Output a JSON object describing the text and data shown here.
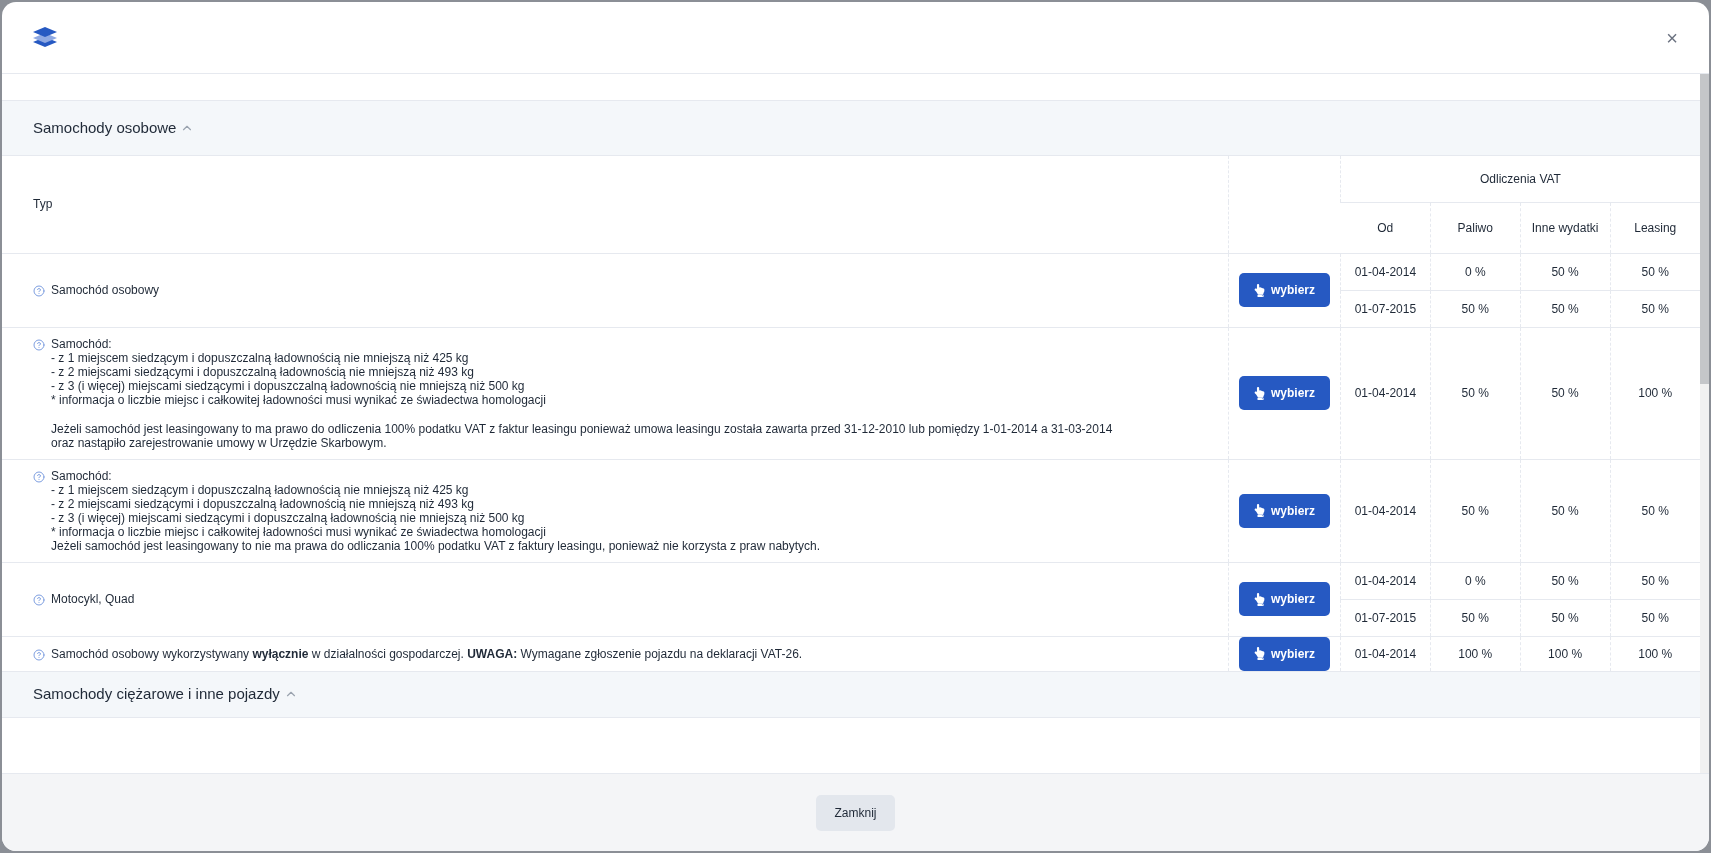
{
  "modal": {
    "close_label": "×",
    "footer_button": "Zamknij"
  },
  "sections": [
    {
      "title": "Samochody osobowe",
      "expanded": true,
      "table": {
        "columns": {
          "type": "Typ",
          "group": "Odliczenia VAT",
          "od": "Od",
          "paliwo": "Paliwo",
          "inne": "Inne wydatki",
          "leasing": "Leasing"
        },
        "rows": [
          {
            "paragraphs": [
              "Samochód osobowy"
            ],
            "button": "wybierz",
            "periods": [
              {
                "od": "01-04-2014",
                "paliwo": "0 %",
                "inne": "50 %",
                "leasing": "50 %"
              },
              {
                "od": "01-07-2015",
                "paliwo": "50 %",
                "inne": "50 %",
                "leasing": "50 %"
              }
            ]
          },
          {
            "paragraphs": [
              "Samochód:\n- z 1 miejscem siedzącym i dopuszczalną ładownością nie mniejszą niż 425 kg\n- z 2 miejscami siedzącymi i dopuszczalną ładownością nie mniejszą niż 493 kg\n- z 3 (i więcej) miejscami siedzącymi i dopuszczalną ładownością nie mniejszą niż 500 kg\n* informacja o liczbie miejsc i całkowitej ładowności musi wynikać ze świadectwa homologacji",
              "Jeżeli samochód jest leasingowany to ma prawo do odliczenia 100% podatku VAT z faktur leasingu ponieważ umowa leasingu została zawarta przed 31-12-2010 lub pomiędzy 1-01-2014 a 31-03-2014\noraz nastąpiło zarejestrowanie umowy w Urzędzie Skarbowym."
            ],
            "button": "wybierz",
            "periods": [
              {
                "od": "01-04-2014",
                "paliwo": "50 %",
                "inne": "50 %",
                "leasing": "100 %"
              }
            ]
          },
          {
            "paragraphs": [
              "Samochód:\n- z 1 miejscem siedzącym i dopuszczalną ładownością nie mniejszą niż 425 kg\n- z 2 miejscami siedzącymi i dopuszczalną ładownością nie mniejszą niż 493 kg\n- z 3 (i więcej) miejscami siedzącymi i dopuszczalną ładownością nie mniejszą niż 500 kg\n* informacja o liczbie miejsc i całkowitej ładowności musi wynikać ze świadectwa homologacji\nJeżeli samochód jest leasingowany to nie ma prawa do odliczania 100% podatku VAT z faktury leasingu, ponieważ nie korzysta z praw nabytych."
            ],
            "button": "wybierz",
            "periods": [
              {
                "od": "01-04-2014",
                "paliwo": "50 %",
                "inne": "50 %",
                "leasing": "50 %"
              }
            ]
          },
          {
            "paragraphs": [
              "Motocykl, Quad"
            ],
            "button": "wybierz",
            "periods": [
              {
                "od": "01-04-2014",
                "paliwo": "0 %",
                "inne": "50 %",
                "leasing": "50 %"
              },
              {
                "od": "01-07-2015",
                "paliwo": "50 %",
                "inne": "50 %",
                "leasing": "50 %"
              }
            ]
          },
          {
            "paragraphs": [
              "Samochód osobowy wykorzystywany  **wyłącznie**  w działalności gospodarczej.  **UWAGA:**  Wymagane zgłoszenie pojazdu na deklaracji VAT-26."
            ],
            "button": "wybierz",
            "periods": [
              {
                "od": "01-04-2014",
                "paliwo": "100 %",
                "inne": "100 %",
                "leasing": "100 %"
              }
            ]
          }
        ]
      }
    },
    {
      "title": "Samochody ciężarowe i inne pojazdy",
      "expanded": true
    }
  ]
}
